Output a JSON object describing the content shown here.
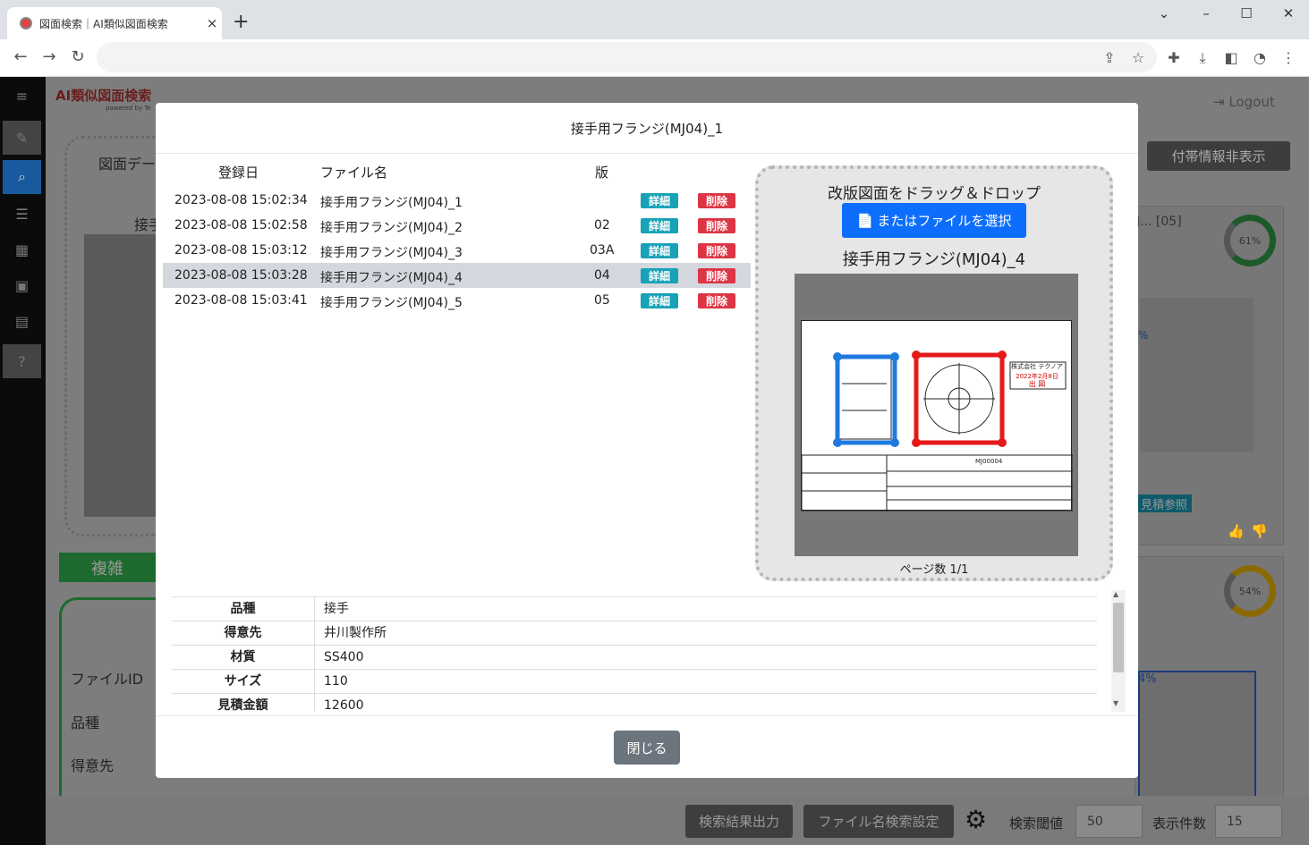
{
  "browser": {
    "tab_title": "図面検索｜AI類似図面検索",
    "close_glyph": "×",
    "newtab_glyph": "+"
  },
  "app": {
    "logo_text": "AI類似図面検索",
    "logo_sub": "powered by Te",
    "logout": "Logout",
    "hide_btn": "付帯情報非表示",
    "left_partial_title": "図面デー",
    "left_partial_name": "接手",
    "complex_label": "複雑",
    "field_labels": [
      "ファイルID",
      "品種",
      "得意先"
    ],
    "result_partial_name": "J... [05]",
    "result1_pct": "61%",
    "result2_pct": "54%",
    "result_pct_small1": "%",
    "result_pct_small2": "4%",
    "estimate_ref": "見積参照",
    "export_btn": "検索結果出力",
    "filename_btn": "ファイル名検索設定",
    "threshold_label": "検索閾値",
    "threshold_value": "50",
    "count_label": "表示件数",
    "count_value": "15"
  },
  "modal": {
    "title": "接手用フランジ(MJ04)_1",
    "headers": {
      "date": "登録日",
      "file": "ファイル名",
      "rev": "版"
    },
    "rows": [
      {
        "date": "2023-08-08 15:02:34",
        "file": "接手用フランジ(MJ04)_1",
        "rev": "",
        "detail": "詳細",
        "delete": "削除"
      },
      {
        "date": "2023-08-08 15:02:58",
        "file": "接手用フランジ(MJ04)_2",
        "rev": "02",
        "detail": "詳細",
        "delete": "削除"
      },
      {
        "date": "2023-08-08 15:03:12",
        "file": "接手用フランジ(MJ04)_3",
        "rev": "03A",
        "detail": "詳細",
        "delete": "削除"
      },
      {
        "date": "2023-08-08 15:03:28",
        "file": "接手用フランジ(MJ04)_4",
        "rev": "04",
        "detail": "詳細",
        "delete": "削除"
      },
      {
        "date": "2023-08-08 15:03:41",
        "file": "接手用フランジ(MJ04)_5",
        "rev": "05",
        "detail": "詳細",
        "delete": "削除"
      }
    ],
    "dropzone": {
      "title": "改版図面をドラッグ＆ドロップ",
      "file_button": "またはファイルを選択",
      "file_name": "接手用フランジ(MJ04)_4",
      "pages": "ページ数 1/1"
    },
    "drawing": {
      "company": "株式会社 テクノア",
      "stamp_date": "2022年2月8日",
      "stamp_text": "出 図",
      "part_no": "MJ00004"
    },
    "props": [
      {
        "k": "品種",
        "v": "接手"
      },
      {
        "k": "得意先",
        "v": "井川製作所"
      },
      {
        "k": "材質",
        "v": "SS400"
      },
      {
        "k": "サイズ",
        "v": "110"
      },
      {
        "k": "見積金額",
        "v": "12600"
      }
    ],
    "close": "閉じる"
  },
  "colors": {
    "primary": "#0d6efd",
    "info": "#17a2b8",
    "danger": "#dc3545",
    "secondary": "#6c757d",
    "blue_box": "#1f7ae0",
    "red_box": "#e61919"
  }
}
